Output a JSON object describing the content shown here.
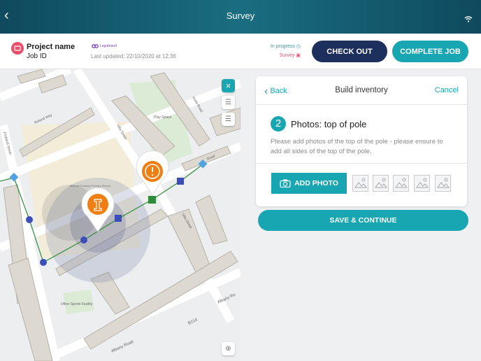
{
  "topbar": {
    "title": "Survey",
    "back_icon": "chevron-left-icon",
    "wifi_icon": "wifi-icon"
  },
  "header": {
    "project_name": "Project name",
    "job_id": "Job ID",
    "logo_text": "Logobrand",
    "last_updated": "Last updated: 22/10/2020 at 12:36",
    "status": "In progress",
    "type": "Survey",
    "checkout_label": "CHECK OUT",
    "complete_label": "COMPLETE JOB"
  },
  "map": {
    "labels": {
      "roland": "Roland Way",
      "portland": "Portland Street",
      "villa1": "Villa Street",
      "villa2": "Villa Street",
      "invile": "Invile Road",
      "play": "Play Space",
      "school": "Michael Faraday Primary School",
      "sports": "Other Sports Facility",
      "albany1": "Albany Road",
      "albany2": "Albany Ro",
      "b214": "B214",
      "road": "Road"
    },
    "colors": {
      "route": "#2e8b3a",
      "node": "#3b4db8",
      "diamond": "#4ea3e0",
      "pin": "#f07f13"
    }
  },
  "panel": {
    "back_label": "Back",
    "title": "Build inventory",
    "cancel_label": "Cancel",
    "step_number": "2",
    "step_title": "Photos: top of pole",
    "description": "Please add photos of the top of the pole - please ensure to add all sides of the top of the pole.",
    "add_photo_label": "ADD PHOTO",
    "save_label": "SAVE & CONTINUE"
  },
  "colors": {
    "accent": "#18a7b2",
    "navy": "#1d2f5c",
    "pink": "#e94f6d"
  }
}
